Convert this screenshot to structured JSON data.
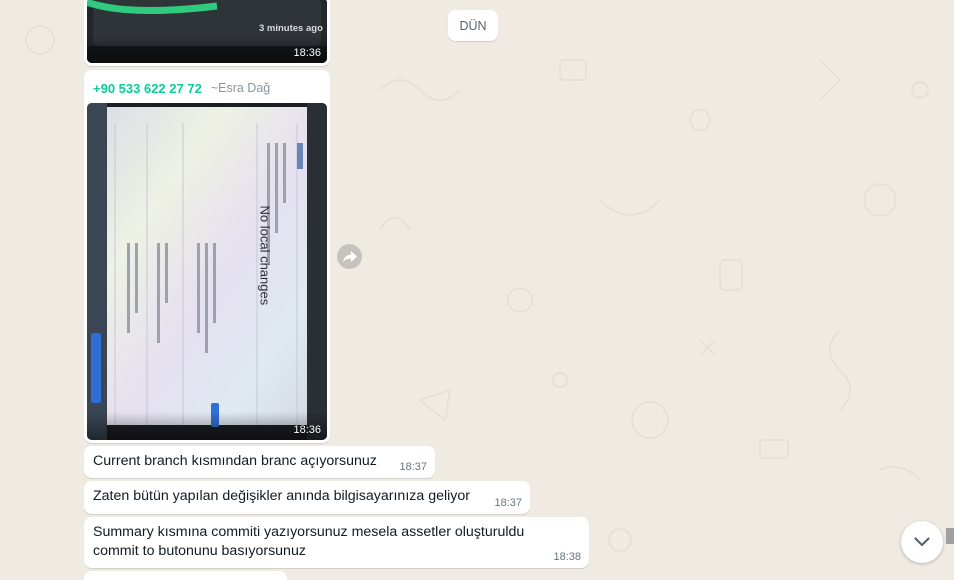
{
  "day_separator": "DÜN",
  "colors": {
    "chat_background": "#efeae2",
    "bubble": "#ffffff",
    "sender_phone": "#06cf9c",
    "meta_text": "#667781"
  },
  "messages": [
    {
      "kind": "image",
      "time": "18:36",
      "image_overlay_text": "3 minutes ago"
    },
    {
      "kind": "image",
      "sender_phone": "+90 533 622 27 72",
      "sender_name": "~Esra Dağ",
      "time": "18:36",
      "photo_content": {
        "heading": "No local changes"
      }
    },
    {
      "kind": "text",
      "text": "Current branch kısmından branc açıyorsunuz",
      "time": "18:37"
    },
    {
      "kind": "text",
      "text": "Zaten bütün yapılan değişikler anında bilgisayarınıza geliyor",
      "time": "18:37"
    },
    {
      "kind": "text",
      "text": "Summary kısmına commiti yazıyorsunuz mesela assetler oluşturuldu commit to butonunu basıyorsunuz",
      "time": "18:38"
    }
  ],
  "icons": {
    "forward": "forward-arrow-icon",
    "scroll_down": "chevron-down-icon"
  }
}
